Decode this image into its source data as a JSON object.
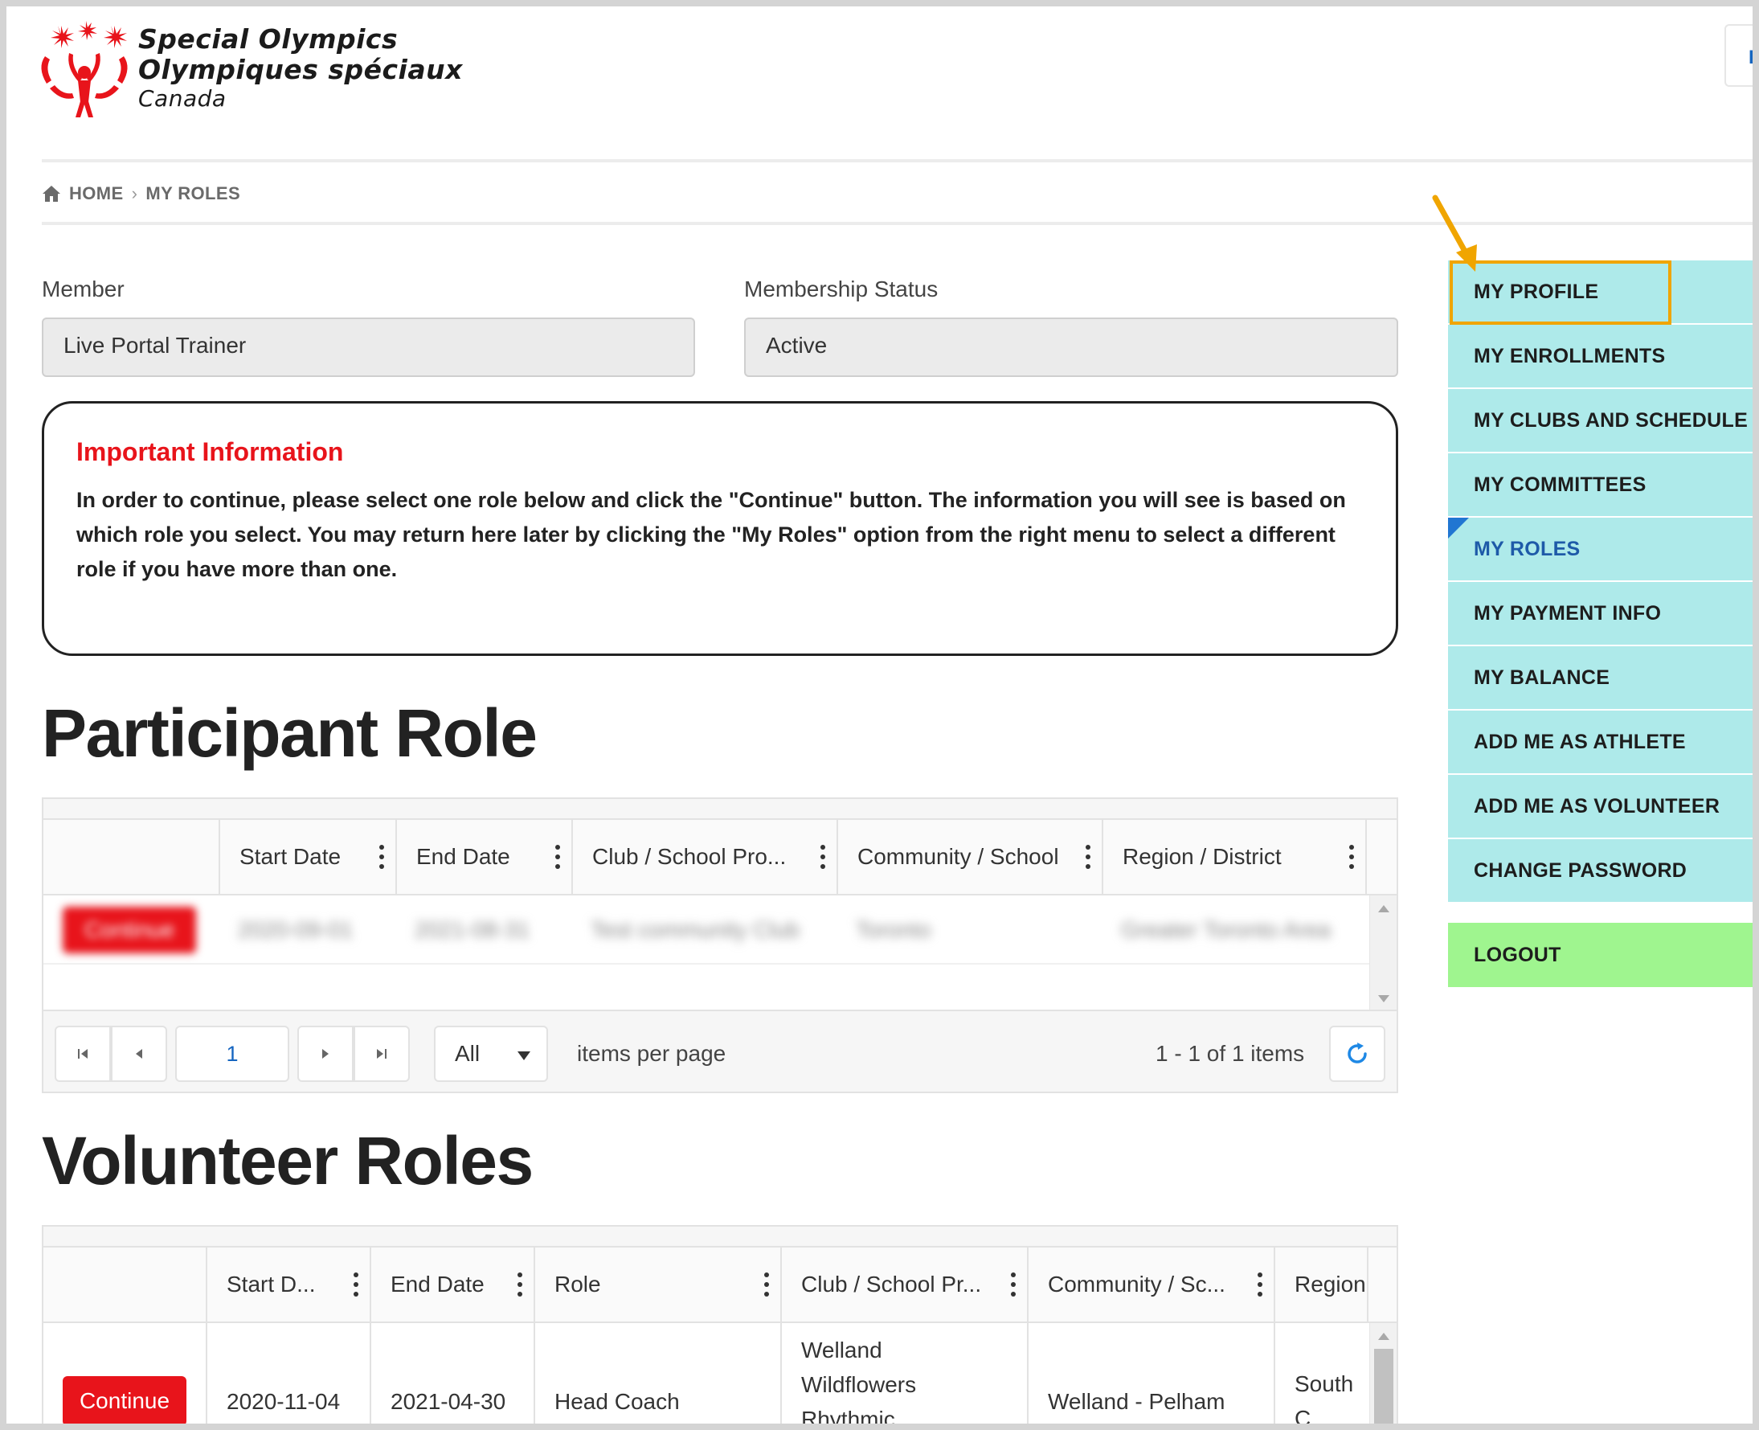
{
  "header": {
    "brand_line1": "Special Olympics",
    "brand_line2": "Olympiques spéciaux",
    "brand_line3": "Canada",
    "lang_button": "E",
    "logo_color": "#e8141b"
  },
  "breadcrumb": {
    "home": "HOME",
    "current": "MY ROLES"
  },
  "member": {
    "label": "Member",
    "value": "Live Portal Trainer"
  },
  "membership_status": {
    "label": "Membership Status",
    "value": "Active"
  },
  "info": {
    "title": "Important Information",
    "text": "In order to continue, please select one role below and click the \"Continue\" button. The information you will see is based on which role you select. You may return here later by clicking the \"My Roles\" option from the right menu to select a different role if you have more than one."
  },
  "participant": {
    "title": "Participant Role",
    "columns": [
      "Start Date",
      "End Date",
      "Club / School Pro...",
      "Community / School",
      "Region / District"
    ],
    "row": {
      "button": "Continue",
      "start": "2020-09-01",
      "end": "2021-08-31",
      "club": "Test community Club",
      "community": "Toronto",
      "region": "Greater Toronto Area"
    },
    "pager": {
      "page": "1",
      "page_size": "All",
      "items_per_page": "items per page",
      "summary": "1 - 1 of 1 items"
    }
  },
  "volunteer": {
    "title": "Volunteer Roles",
    "columns": [
      "Start D...",
      "End Date",
      "Role",
      "Club / School Pr...",
      "Community / Sc...",
      "Region"
    ],
    "row": {
      "button": "Continue",
      "start": "2020-11-04",
      "end": "2021-04-30",
      "role": "Head Coach",
      "club": "Welland Wildflowers Rhythmic",
      "community": "Welland - Pelham",
      "region": "South C Ontario"
    }
  },
  "menu": {
    "items": [
      "MY PROFILE",
      "MY ENROLLMENTS",
      "MY CLUBS AND SCHEDULE",
      "MY COMMITTEES",
      "MY ROLES",
      "MY PAYMENT INFO",
      "MY BALANCE",
      "ADD ME AS ATHLETE",
      "ADD ME AS VOLUNTEER",
      "CHANGE PASSWORD"
    ],
    "logout": "LOGOUT",
    "active": "MY ROLES",
    "highlighted": "MY PROFILE",
    "menu_color": "#aeeaea",
    "logout_color": "#9ff58f",
    "highlight_color": "#f0a500"
  }
}
